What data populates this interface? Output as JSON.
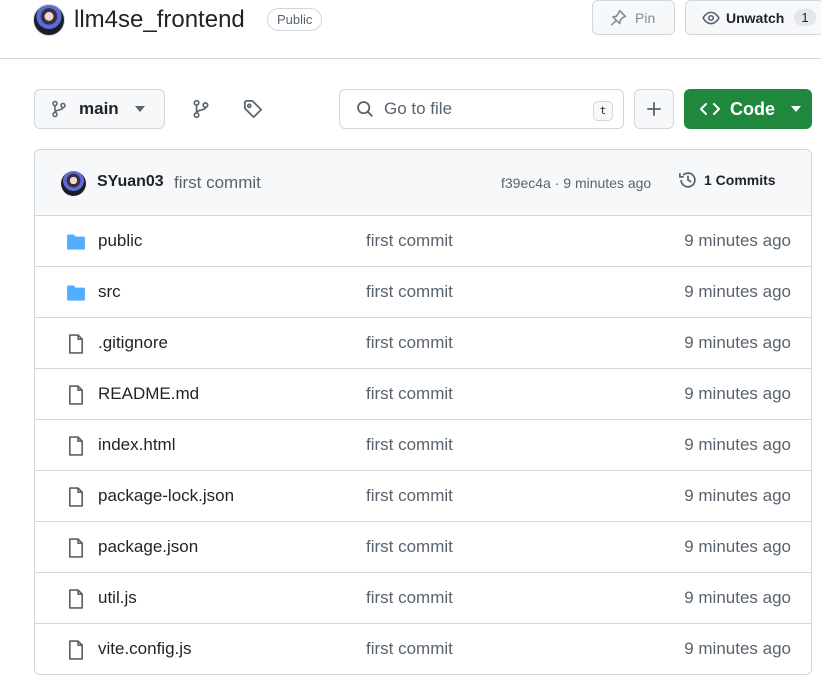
{
  "repo": {
    "name": "llm4se_frontend",
    "visibility": "Public",
    "pin_label": "Pin",
    "watch_label": "Unwatch",
    "watch_count": "1"
  },
  "toolbar": {
    "branch": "main",
    "search_placeholder": "Go to file",
    "search_shortcut": "t",
    "code_label": "Code"
  },
  "latest_commit": {
    "author": "SYuan03",
    "message": "first commit",
    "hash_time": "f39ec4a · 9 minutes ago",
    "commits_label": "1 Commits"
  },
  "files": [
    {
      "name": "public",
      "type": "dir",
      "message": "first commit",
      "time": "9 minutes ago"
    },
    {
      "name": "src",
      "type": "dir",
      "message": "first commit",
      "time": "9 minutes ago"
    },
    {
      "name": ".gitignore",
      "type": "file",
      "message": "first commit",
      "time": "9 minutes ago"
    },
    {
      "name": "README.md",
      "type": "file",
      "message": "first commit",
      "time": "9 minutes ago"
    },
    {
      "name": "index.html",
      "type": "file",
      "message": "first commit",
      "time": "9 minutes ago"
    },
    {
      "name": "package-lock.json",
      "type": "file",
      "message": "first commit",
      "time": "9 minutes ago"
    },
    {
      "name": "package.json",
      "type": "file",
      "message": "first commit",
      "time": "9 minutes ago"
    },
    {
      "name": "util.js",
      "type": "file",
      "message": "first commit",
      "time": "9 minutes ago"
    },
    {
      "name": "vite.config.js",
      "type": "file",
      "message": "first commit",
      "time": "9 minutes ago"
    }
  ],
  "colors": {
    "accent_green": "#1f883d",
    "folder_blue": "#54aeff",
    "muted_text": "#59636e",
    "border": "#d0d7de"
  }
}
